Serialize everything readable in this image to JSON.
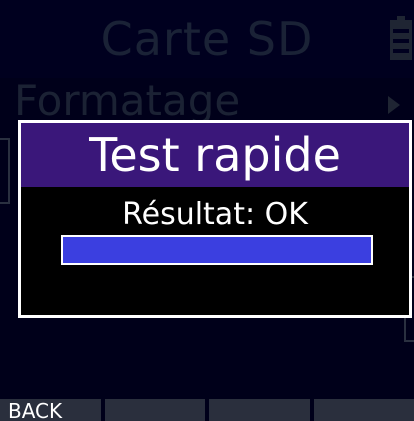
{
  "header": {
    "title": "Carte SD",
    "battery_icon": "battery-icon"
  },
  "menu": {
    "items": [
      "Formatage"
    ],
    "arrow_icon": "chevron-right-icon"
  },
  "dialog": {
    "title": "Test rapide",
    "result": "Résultat: OK",
    "progress": 1.0,
    "colors": {
      "title_bar": "#3a177a",
      "progress_fill": "#3b3fe0",
      "border": "#ffffff"
    }
  },
  "softkeys": [
    "BACK",
    "",
    "",
    ""
  ]
}
